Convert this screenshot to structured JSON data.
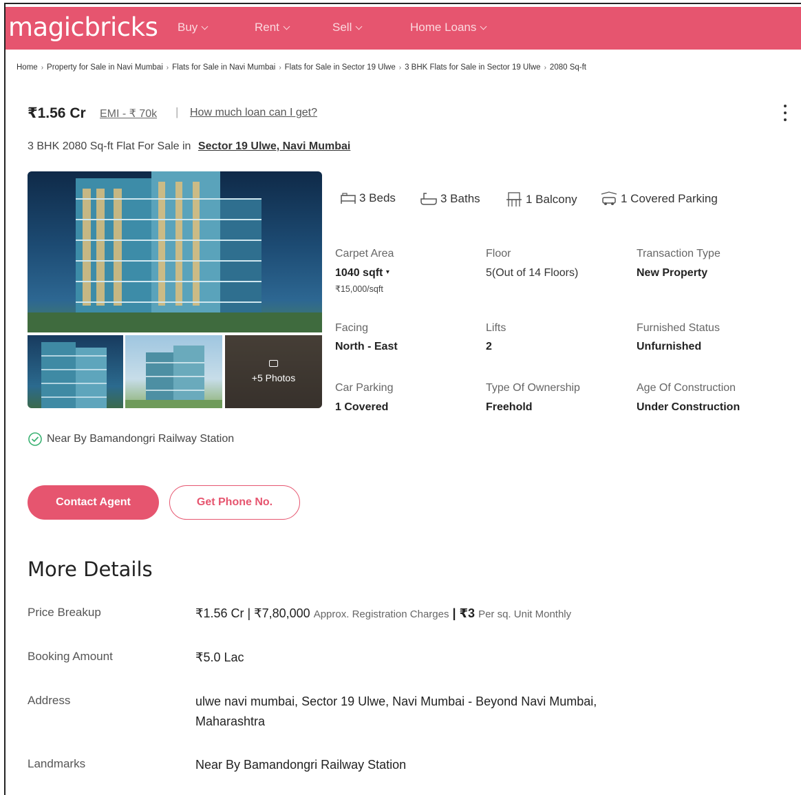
{
  "header": {
    "logo": "magicbricks",
    "nav": [
      {
        "label": "Buy"
      },
      {
        "label": "Rent"
      },
      {
        "label": "Sell"
      },
      {
        "label": "Home Loans"
      }
    ]
  },
  "breadcrumb": [
    "Home",
    "Property for Sale in Navi Mumbai",
    "Flats for Sale in Navi Mumbai",
    "Flats for Sale in Sector 19 Ulwe",
    "3 BHK Flats for Sale in Sector 19 Ulwe",
    "2080 Sq-ft"
  ],
  "listing": {
    "price": "₹1.56 Cr",
    "emi": "EMI - ₹ 70k",
    "loan_link": "How much loan can I get?",
    "title_prefix": "3 BHK 2080 Sq-ft Flat For Sale in",
    "location": "Sector 19 Ulwe, Navi Mumbai",
    "photos_more": "+5 Photos"
  },
  "amenities": {
    "beds": "3 Beds",
    "baths": "3 Baths",
    "balcony": "1 Balcony",
    "parking": "1 Covered Parking"
  },
  "specs": {
    "carpet_area": {
      "label": "Carpet Area",
      "value": "1040 sqft",
      "sub": "₹15,000/sqft"
    },
    "floor": {
      "label": "Floor",
      "value": "5(Out of 14 Floors)"
    },
    "transaction": {
      "label": "Transaction Type",
      "value": "New Property"
    },
    "facing": {
      "label": "Facing",
      "value": "North - East"
    },
    "lifts": {
      "label": "Lifts",
      "value": "2"
    },
    "furnished": {
      "label": "Furnished Status",
      "value": "Unfurnished"
    },
    "car_parking": {
      "label": "Car Parking",
      "value": "1 Covered"
    },
    "ownership": {
      "label": "Type Of Ownership",
      "value": "Freehold"
    },
    "age": {
      "label": "Age Of Construction",
      "value": "Under Construction"
    }
  },
  "near_by": "Near By Bamandongri Railway Station",
  "buttons": {
    "contact": "Contact Agent",
    "phone": "Get Phone No."
  },
  "more_details": {
    "title": "More Details",
    "price_breakup": {
      "label": "Price Breakup",
      "price": "₹1.56 Cr | ₹7,80,000",
      "reg_note": "Approx. Registration Charges",
      "maint": "| ₹3",
      "maint_note": "Per sq. Unit Monthly"
    },
    "booking": {
      "label": "Booking Amount",
      "value": "₹5.0 Lac"
    },
    "address": {
      "label": "Address",
      "line1": "ulwe navi mumbai, Sector 19 Ulwe, Navi Mumbai - Beyond Navi Mumbai,",
      "line2": "Maharashtra"
    },
    "landmarks": {
      "label": "Landmarks",
      "value": "Near By Bamandongri Railway Station"
    }
  },
  "colors": {
    "brand": "#e6556f",
    "text": "#222222",
    "muted": "#666666"
  }
}
